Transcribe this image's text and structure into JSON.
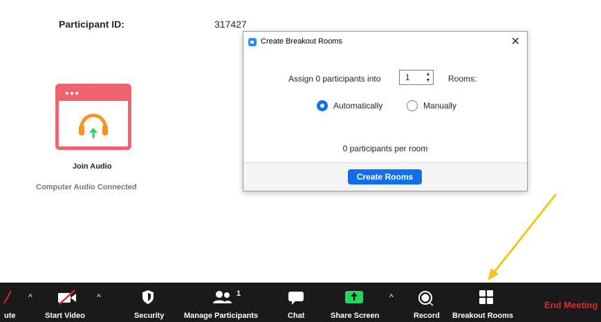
{
  "participant": {
    "label": "Participant ID:",
    "value": "317427"
  },
  "audio_panel": {
    "title": "Join Audio",
    "status": "Computer Audio Connected"
  },
  "dialog": {
    "title": "Create Breakout Rooms",
    "close": "✕",
    "assign_text": "Assign 0 participants into",
    "rooms_count": "1",
    "rooms_suffix": "Rooms:",
    "option_auto": "Automatically",
    "option_manual": "Manually",
    "selected_option": "Automatically",
    "per_room": "0 participants per room",
    "create_button": "Create Rooms"
  },
  "toolbar": {
    "mute_fragment": "ute",
    "start_video": "Start Video",
    "security": "Security",
    "manage_participants": "Manage Participants",
    "participant_count": "1",
    "chat": "Chat",
    "share_screen": "Share Screen",
    "record": "Record",
    "breakout_rooms": "Breakout Rooms",
    "end_meeting": "End Meeting",
    "caret": "^"
  },
  "colors": {
    "accent_blue": "#0e71eb",
    "audio_card_red": "#f1636d",
    "headphone_orange": "#f7931e",
    "share_green": "#23d959",
    "end_meeting_red": "#e02828",
    "arrow_annotation": "#f5c518",
    "toolbar_bg": "#1a1a1a"
  }
}
